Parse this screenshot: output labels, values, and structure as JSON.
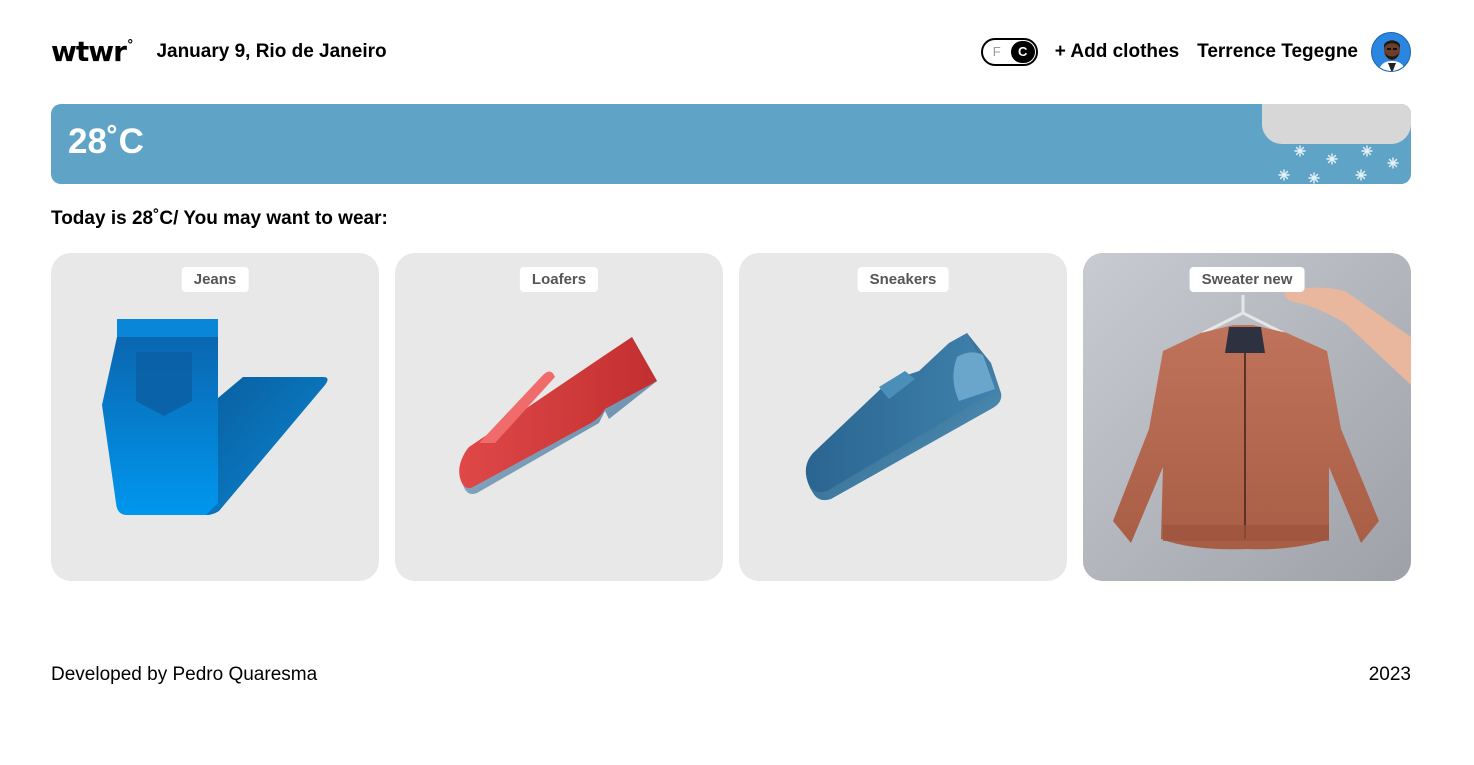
{
  "header": {
    "logo": "wtwr",
    "logo_mark": "°",
    "date_location": "January 9, Rio de Janeiro",
    "unit_toggle": {
      "off_label": "F",
      "on_label": "C",
      "selected": "C"
    },
    "add_clothes_label": "+ Add clothes",
    "user_name": "Terrence Tegegne"
  },
  "weather": {
    "temperature": "28˚C",
    "condition_icon": "cloud-snow-icon"
  },
  "recommendation": "Today is 28˚C/ You may want to wear:",
  "cards": [
    {
      "label": "Jeans",
      "icon": "jeans-icon",
      "color": "#0a7cd0"
    },
    {
      "label": "Loafers",
      "icon": "loafers-icon",
      "color": "#d63c3c"
    },
    {
      "label": "Sneakers",
      "icon": "sneakers-icon",
      "color": "#2f6e95"
    },
    {
      "label": "Sweater new",
      "icon": "jacket-photo",
      "color": "#b5684c"
    }
  ],
  "footer": {
    "credit": "Developed by Pedro Quaresma",
    "year": "2023"
  },
  "colors": {
    "weather_banner": "#5fa4c6",
    "card_background": "#e8e8e8",
    "cloud": "#d7d7d7"
  }
}
